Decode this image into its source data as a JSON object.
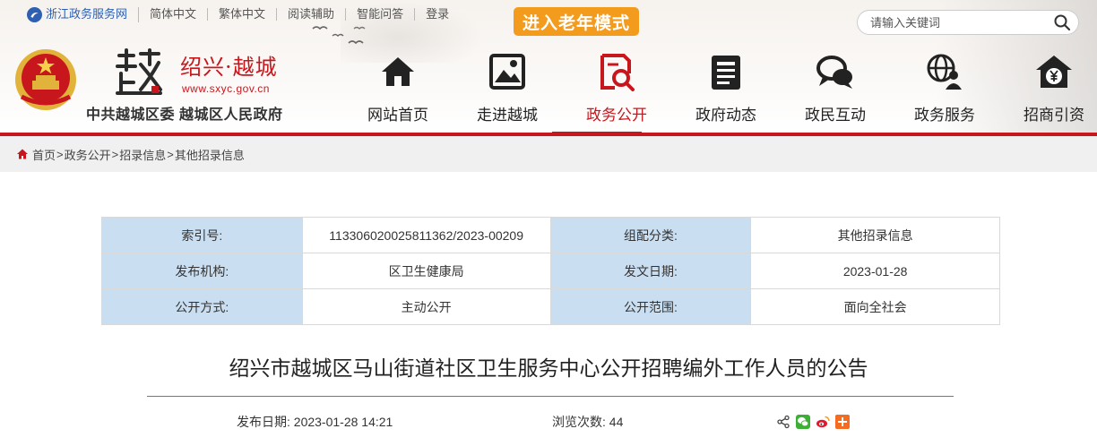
{
  "topbar": {
    "portal": "浙江政务服务网",
    "simplified": "简体中文",
    "traditional": "繁体中文",
    "reading": "阅读辅助",
    "qa": "智能问答",
    "login": "登录"
  },
  "elder_mode": "进入老年模式",
  "search": {
    "placeholder": "请输入关键词"
  },
  "brand": {
    "char": "越",
    "title": "绍兴·越城",
    "url": "www.sxyc.gov.cn",
    "org": "中共越城区委  越城区人民政府"
  },
  "nav": [
    {
      "label": "网站首页",
      "icon": "home-icon"
    },
    {
      "label": "走进越城",
      "icon": "picture-icon"
    },
    {
      "label": "政务公开",
      "icon": "document-search-icon",
      "active": true
    },
    {
      "label": "政府动态",
      "icon": "news-icon"
    },
    {
      "label": "政民互动",
      "icon": "chat-icon"
    },
    {
      "label": "政务服务",
      "icon": "globe-person-icon"
    },
    {
      "label": "招商引资",
      "icon": "yuan-house-icon"
    }
  ],
  "breadcrumb": {
    "home": "首页",
    "l1": "政务公开",
    "l2": "招录信息",
    "l3": "其他招录信息",
    "sep": ">"
  },
  "info": {
    "index_label": "索引号:",
    "index_value": "113306020025811362/2023-00209",
    "category_label": "组配分类:",
    "category_value": "其他招录信息",
    "publisher_label": "发布机构:",
    "publisher_value": "区卫生健康局",
    "doc_date_label": "发文日期:",
    "doc_date_value": "2023-01-28",
    "open_mode_label": "公开方式:",
    "open_mode_value": "主动公开",
    "open_scope_label": "公开范围:",
    "open_scope_value": "面向全社会"
  },
  "article": {
    "title": "绍兴市越城区马山街道社区卫生服务中心公开招聘编外工作人员的公告",
    "publish_label": "发布日期:",
    "publish_value": "2023-01-28 14:21",
    "views_label": "浏览次数:",
    "views_value": "44"
  },
  "colors": {
    "brand_red": "#c8161d",
    "elder_orange": "#f39b1d",
    "table_key_bg": "#c9def0",
    "portal_blue": "#2d5fb3"
  }
}
